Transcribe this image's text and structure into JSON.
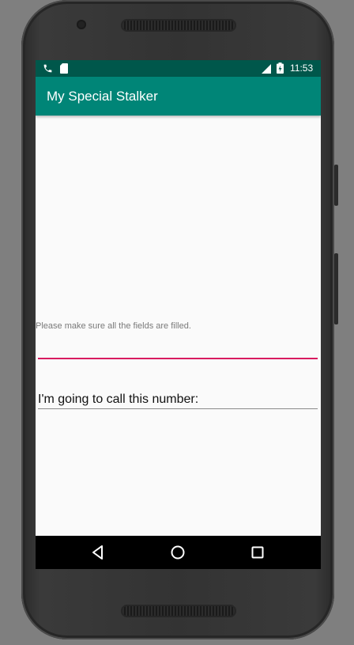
{
  "status_bar": {
    "time": "11:53",
    "left_icons": [
      "phone-call-icon",
      "sd-card-icon"
    ],
    "right_icons": [
      "signal-icon",
      "battery-charging-icon"
    ]
  },
  "toolbar": {
    "title": "My Special Stalker"
  },
  "form": {
    "error_message": "Please make sure all the fields are filled.",
    "input_value": "",
    "call_label": "I'm going to call this number:"
  },
  "nav_bar": {
    "buttons": [
      "back-icon",
      "home-icon",
      "recents-icon"
    ]
  },
  "colors": {
    "status_bar": "#00574b",
    "toolbar": "#008577",
    "accent": "#d81b60",
    "background": "#fafafa"
  }
}
